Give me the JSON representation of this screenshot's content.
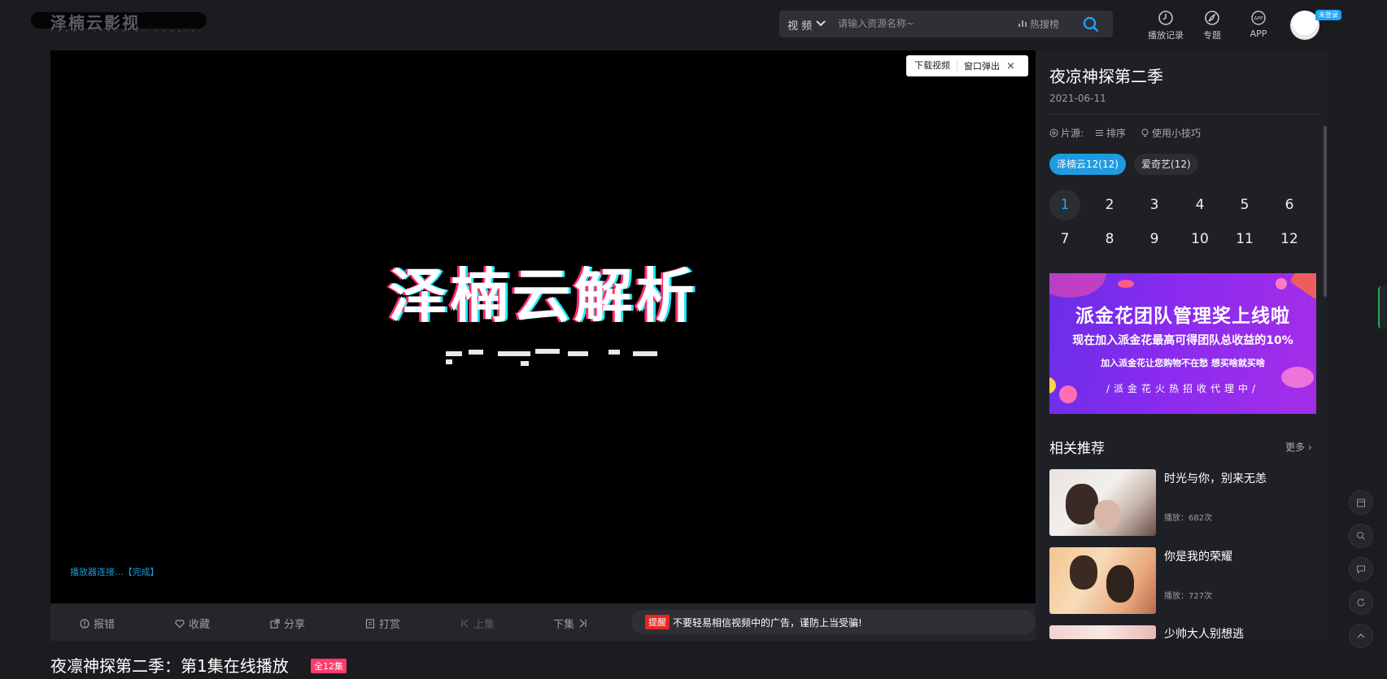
{
  "header": {
    "logo_text": "泽楠云影视",
    "logo_sub": "Zenan cloud av theater",
    "search": {
      "type_label": "视 频",
      "placeholder": "请输入资源名称~",
      "hot_search": "热搜榜"
    },
    "nav": [
      {
        "label": "播放记录",
        "icon": "clock-icon"
      },
      {
        "label": "专题",
        "icon": "compass-icon"
      },
      {
        "label": "APP",
        "icon": "app-icon"
      }
    ],
    "login_badge": "未登录"
  },
  "player": {
    "splash_title": "泽楠云解析",
    "status": "播放器连接...【完成】",
    "popup": {
      "download": "下载视频",
      "window": "窗口弹出",
      "close": "×"
    },
    "controls": [
      {
        "label": "报错",
        "icon": "alert-icon",
        "enabled": true
      },
      {
        "label": "收藏",
        "icon": "heart-icon",
        "enabled": true
      },
      {
        "label": "分享",
        "icon": "share-icon",
        "enabled": true
      },
      {
        "label": "打赏",
        "icon": "reward-icon",
        "enabled": true
      },
      {
        "label": "上集",
        "icon": "prev-icon",
        "enabled": false
      },
      {
        "label": "下集",
        "icon": "next-icon",
        "enabled": true
      }
    ],
    "notice_tag": "提醒",
    "notice_text": "不要轻易相信视频中的广告，谨防上当受骗!"
  },
  "page": {
    "title": "夜凛神探第二季：第1集在线播放",
    "episode_badge": "全12集"
  },
  "sidebar": {
    "title": "夜凉神探第二季",
    "date": "2021-06-11",
    "source_label": "片源:",
    "sort_label": "排序",
    "tips_label": "使用小技巧",
    "sources": [
      {
        "label": "泽楠云12(12)",
        "active": true
      },
      {
        "label": "爱奇艺(12)",
        "active": false
      }
    ],
    "episodes": [
      "1",
      "2",
      "3",
      "4",
      "5",
      "6",
      "7",
      "8",
      "9",
      "10",
      "11",
      "12"
    ],
    "active_episode": "1",
    "ad": {
      "line1": "派金花团队管理奖上线啦",
      "line2": "现在加入派金花最高可得团队总收益的10%",
      "line3": "加入派金花让您购物不在愁  想买啥就买啥",
      "line4": "/派金花火热招收代理中/"
    },
    "related": {
      "title": "相关推荐",
      "more": "更多",
      "items": [
        {
          "name": "时光与你，别来无恙",
          "plays": "播放：682次"
        },
        {
          "name": "你是我的荣耀",
          "plays": "播放：727次"
        },
        {
          "name": "少帅大人别想逃",
          "plays": ""
        }
      ]
    }
  },
  "colors": {
    "accent": "#1ea5ff",
    "background": "#1b1c20",
    "panel": "#1f2025",
    "notice_red": "#e8261d",
    "badge_pink": "#ff3b6b"
  }
}
